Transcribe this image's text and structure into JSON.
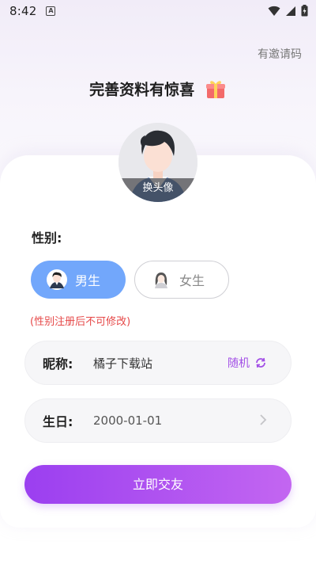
{
  "status_bar": {
    "time": "8:42",
    "notification_glyph": "A"
  },
  "header": {
    "invite_code_label": "有邀请码",
    "title": "完善资料有惊喜",
    "title_icon": "gift-icon"
  },
  "avatar": {
    "change_label": "换头像"
  },
  "gender": {
    "label": "性别:",
    "options": [
      {
        "label": "男生",
        "selected": true,
        "icon": "male-avatar-icon"
      },
      {
        "label": "女生",
        "selected": false,
        "icon": "female-avatar-icon"
      }
    ],
    "note": "(性别注册后不可修改)"
  },
  "nickname": {
    "label": "昵称:",
    "value": "橘子下载站",
    "random_label": "随机"
  },
  "birthday": {
    "label": "生日:",
    "value": "2000-01-01"
  },
  "submit": {
    "label": "立即交友"
  },
  "colors": {
    "accent_start": "#9b3ff0",
    "accent_end": "#c366f1",
    "male_selected": "#72a7fb",
    "note_red": "#e64848",
    "random_purple": "#a24fe6"
  }
}
